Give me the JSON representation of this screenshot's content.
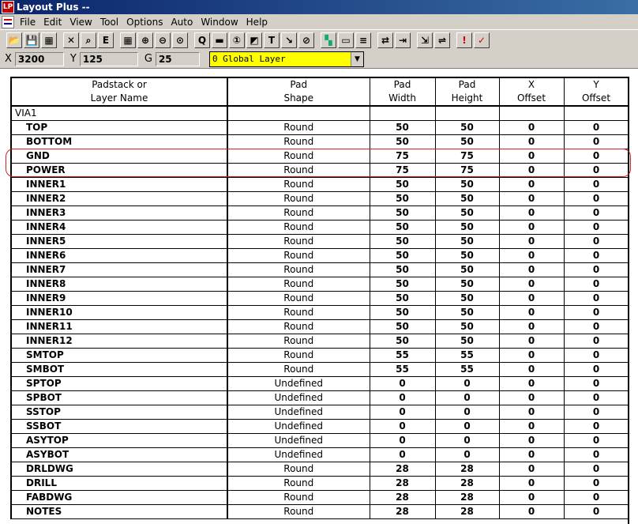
{
  "window": {
    "title": "Layout Plus --",
    "app_icon": "LP"
  },
  "menu": [
    "File",
    "Edit",
    "View",
    "Tool",
    "Options",
    "Auto",
    "Window",
    "Help"
  ],
  "toolbar_icons": [
    "open-folder-icon",
    "save-icon",
    "print-icon",
    "sep",
    "delete-icon",
    "find-icon",
    "edit-icon",
    "sep",
    "spreadsheet-icon",
    "zoom-in-icon",
    "zoom-out-icon",
    "zoom-all-icon",
    "sep",
    "query-icon",
    "component-icon",
    "pin-icon",
    "obstacle-icon",
    "text-icon",
    "connection-icon",
    "error-icon",
    "sep",
    "color-icon",
    "drc-box-icon",
    "refresh-icon",
    "sep",
    "reconnect-icon",
    "pin-swap-icon",
    "sep",
    "shove-icon",
    "autoroute-icon",
    "sep",
    "online-drc-icon",
    "drc-check-icon"
  ],
  "toolbar_glyphs": {
    "open-folder-icon": "📂",
    "save-icon": "💾",
    "print-icon": "▦",
    "delete-icon": "✕",
    "find-icon": "⌕",
    "edit-icon": "E",
    "spreadsheet-icon": "▦",
    "zoom-in-icon": "⊕",
    "zoom-out-icon": "⊖",
    "zoom-all-icon": "⊙",
    "query-icon": "Q",
    "component-icon": "▬",
    "pin-icon": "①",
    "obstacle-icon": "◩",
    "text-icon": "T",
    "connection-icon": "↘",
    "error-icon": "⊘",
    "color-icon": "▚",
    "drc-box-icon": "▭",
    "refresh-icon": "≡",
    "reconnect-icon": "⇄",
    "pin-swap-icon": "⇥",
    "shove-icon": "⇲",
    "autoroute-icon": "⇌",
    "online-drc-icon": "!",
    "drc-check-icon": "✓"
  },
  "coords": {
    "x_label": "X",
    "x_value": "3200",
    "y_label": "Y",
    "y_value": "125",
    "g_label": "G",
    "g_value": "25"
  },
  "layer_select": {
    "value": "0 Global Layer"
  },
  "table": {
    "headers": [
      [
        "Padstack or",
        "Layer Name"
      ],
      [
        "Pad",
        "Shape"
      ],
      [
        "Pad",
        "Width"
      ],
      [
        "Pad",
        "Height"
      ],
      [
        "X",
        "Offset"
      ],
      [
        "Y",
        "Offset"
      ]
    ],
    "rows": [
      {
        "name": "VIA1",
        "padstack": true,
        "shape": "",
        "width": "",
        "height": "",
        "x": "",
        "y": ""
      },
      {
        "name": "TOP",
        "shape": "Round",
        "width": "50",
        "height": "50",
        "x": "0",
        "y": "0"
      },
      {
        "name": "BOTTOM",
        "shape": "Round",
        "width": "50",
        "height": "50",
        "x": "0",
        "y": "0"
      },
      {
        "name": "GND",
        "shape": "Round",
        "width": "75",
        "height": "75",
        "x": "0",
        "y": "0"
      },
      {
        "name": "POWER",
        "shape": "Round",
        "width": "75",
        "height": "75",
        "x": "0",
        "y": "0"
      },
      {
        "name": "INNER1",
        "shape": "Round",
        "width": "50",
        "height": "50",
        "x": "0",
        "y": "0"
      },
      {
        "name": "INNER2",
        "shape": "Round",
        "width": "50",
        "height": "50",
        "x": "0",
        "y": "0"
      },
      {
        "name": "INNER3",
        "shape": "Round",
        "width": "50",
        "height": "50",
        "x": "0",
        "y": "0"
      },
      {
        "name": "INNER4",
        "shape": "Round",
        "width": "50",
        "height": "50",
        "x": "0",
        "y": "0"
      },
      {
        "name": "INNER5",
        "shape": "Round",
        "width": "50",
        "height": "50",
        "x": "0",
        "y": "0"
      },
      {
        "name": "INNER6",
        "shape": "Round",
        "width": "50",
        "height": "50",
        "x": "0",
        "y": "0"
      },
      {
        "name": "INNER7",
        "shape": "Round",
        "width": "50",
        "height": "50",
        "x": "0",
        "y": "0"
      },
      {
        "name": "INNER8",
        "shape": "Round",
        "width": "50",
        "height": "50",
        "x": "0",
        "y": "0"
      },
      {
        "name": "INNER9",
        "shape": "Round",
        "width": "50",
        "height": "50",
        "x": "0",
        "y": "0"
      },
      {
        "name": "INNER10",
        "shape": "Round",
        "width": "50",
        "height": "50",
        "x": "0",
        "y": "0"
      },
      {
        "name": "INNER11",
        "shape": "Round",
        "width": "50",
        "height": "50",
        "x": "0",
        "y": "0"
      },
      {
        "name": "INNER12",
        "shape": "Round",
        "width": "50",
        "height": "50",
        "x": "0",
        "y": "0"
      },
      {
        "name": "SMTOP",
        "shape": "Round",
        "width": "55",
        "height": "55",
        "x": "0",
        "y": "0"
      },
      {
        "name": "SMBOT",
        "shape": "Round",
        "width": "55",
        "height": "55",
        "x": "0",
        "y": "0"
      },
      {
        "name": "SPTOP",
        "shape": "Undefined",
        "width": "0",
        "height": "0",
        "x": "0",
        "y": "0"
      },
      {
        "name": "SPBOT",
        "shape": "Undefined",
        "width": "0",
        "height": "0",
        "x": "0",
        "y": "0"
      },
      {
        "name": "SSTOP",
        "shape": "Undefined",
        "width": "0",
        "height": "0",
        "x": "0",
        "y": "0"
      },
      {
        "name": "SSBOT",
        "shape": "Undefined",
        "width": "0",
        "height": "0",
        "x": "0",
        "y": "0"
      },
      {
        "name": "ASYTOP",
        "shape": "Undefined",
        "width": "0",
        "height": "0",
        "x": "0",
        "y": "0"
      },
      {
        "name": "ASYBOT",
        "shape": "Undefined",
        "width": "0",
        "height": "0",
        "x": "0",
        "y": "0"
      },
      {
        "name": "DRLDWG",
        "shape": "Round",
        "width": "28",
        "height": "28",
        "x": "0",
        "y": "0"
      },
      {
        "name": "DRILL",
        "shape": "Round",
        "width": "28",
        "height": "28",
        "x": "0",
        "y": "0"
      },
      {
        "name": "FABDWG",
        "shape": "Round",
        "width": "28",
        "height": "28",
        "x": "0",
        "y": "0"
      },
      {
        "name": "NOTES",
        "shape": "Round",
        "width": "28",
        "height": "28",
        "x": "0",
        "y": "0"
      }
    ]
  },
  "colors": {
    "title_bar": "#0a246a",
    "chrome": "#d4d0c8",
    "layer_field": "#ffff00",
    "highlight": "#d82020"
  }
}
